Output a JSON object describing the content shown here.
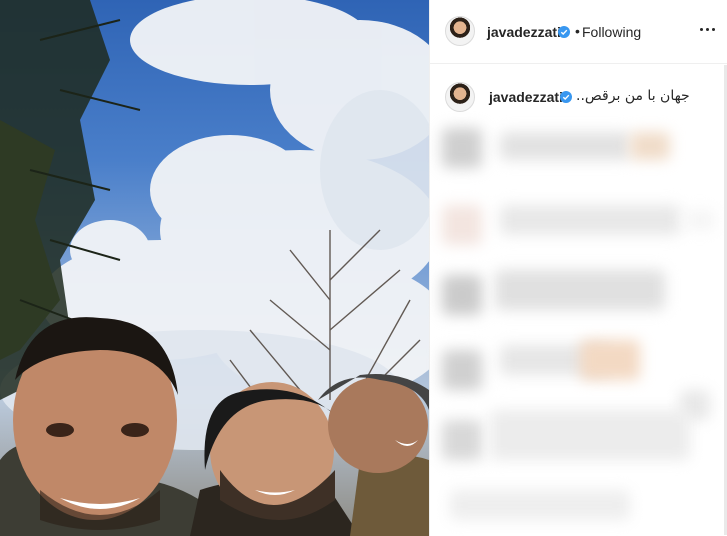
{
  "post": {
    "username": "javadezzati",
    "verified": true,
    "follow_status": "Following",
    "separator": "•",
    "caption": "جهان با من برقص.."
  },
  "icons": {
    "verified": "verified-badge-icon",
    "more": "more-options-icon"
  },
  "colors": {
    "verified": "#3897f0",
    "text": "#262626",
    "border": "#efefef"
  }
}
